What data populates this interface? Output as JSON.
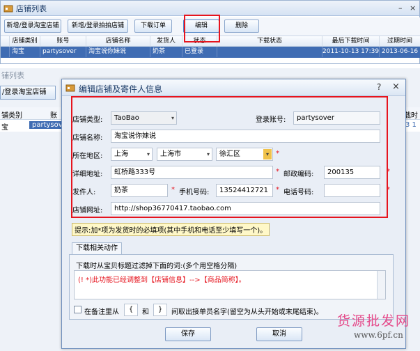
{
  "window1": {
    "title": "店铺列表",
    "toolbar": {
      "add_taobao": "新增/登录淘宝店铺",
      "add_paipai": "新增/登录拍拍店铺",
      "download_orders": "下载订单",
      "edit": "编辑",
      "delete": "删除"
    },
    "columns": [
      "店铺类别",
      "账号",
      "店铺名称",
      "发货人",
      "状态",
      "下载状态",
      "最后下载时间",
      "过期时间"
    ],
    "row": [
      "淘宝",
      "partysover",
      "淘宝说你妹说",
      "奶茶",
      "已登录",
      "",
      "2011-10-13 17:39",
      "2013-06-16"
    ]
  },
  "window2": {
    "title": "铺列表",
    "add_taobao": "/登录淘宝店铺",
    "col_type": "铺类别",
    "col_account": "账",
    "col_time_partial": "载时",
    "row_type": "宝",
    "row_account": "partysover",
    "row_time_partial": "3 1"
  },
  "dialog": {
    "title": "编辑店铺及寄件人信息",
    "help": "?",
    "close": "×",
    "labels": {
      "store_type": "店铺类型:",
      "login_account": "登录账号:",
      "store_name": "店铺名称:",
      "region": "所在地区:",
      "address": "详细地址:",
      "postal_code": "邮政编码:",
      "sender": "发件人:",
      "mobile": "手机号码:",
      "phone": "电话号码:",
      "store_url": "店铺网址:"
    },
    "values": {
      "store_type": "TaoBao",
      "login_account": "partysover",
      "store_name": "淘宝说你妹说",
      "province": "上海",
      "city": "上海市",
      "district": "徐汇区",
      "address": "虹桥路333号",
      "postal_code": "200135",
      "sender": "奶茶",
      "mobile": "13524412721",
      "phone": "",
      "store_url": "http://shop36770417.taobao.com"
    },
    "required_mark": "*",
    "tip": "提示:加*项为发货时的必填项(其中手机和电话至少填写一个)。",
    "tab": "下载相关动作",
    "filter_desc": "下载时从宝贝标题过滤掉下面的词:(多个用空格分隔)",
    "filter_text": "(! *)此功能已经调整到【店铺信息】-->【商品简称】。",
    "remark_prefix": "在备注里从",
    "remark_open": "{",
    "remark_and": "和",
    "remark_close": "}",
    "remark_suffix": "间取出接单员名字(留空为从头开始或末尾结束)。",
    "save": "保存",
    "cancel": "取消"
  },
  "watermark": {
    "line1": "货源批发网",
    "line2": "www.6pf.cn"
  },
  "colors": {
    "highlight_red": "#e6141e",
    "selection_blue": "#3f6cb3"
  }
}
